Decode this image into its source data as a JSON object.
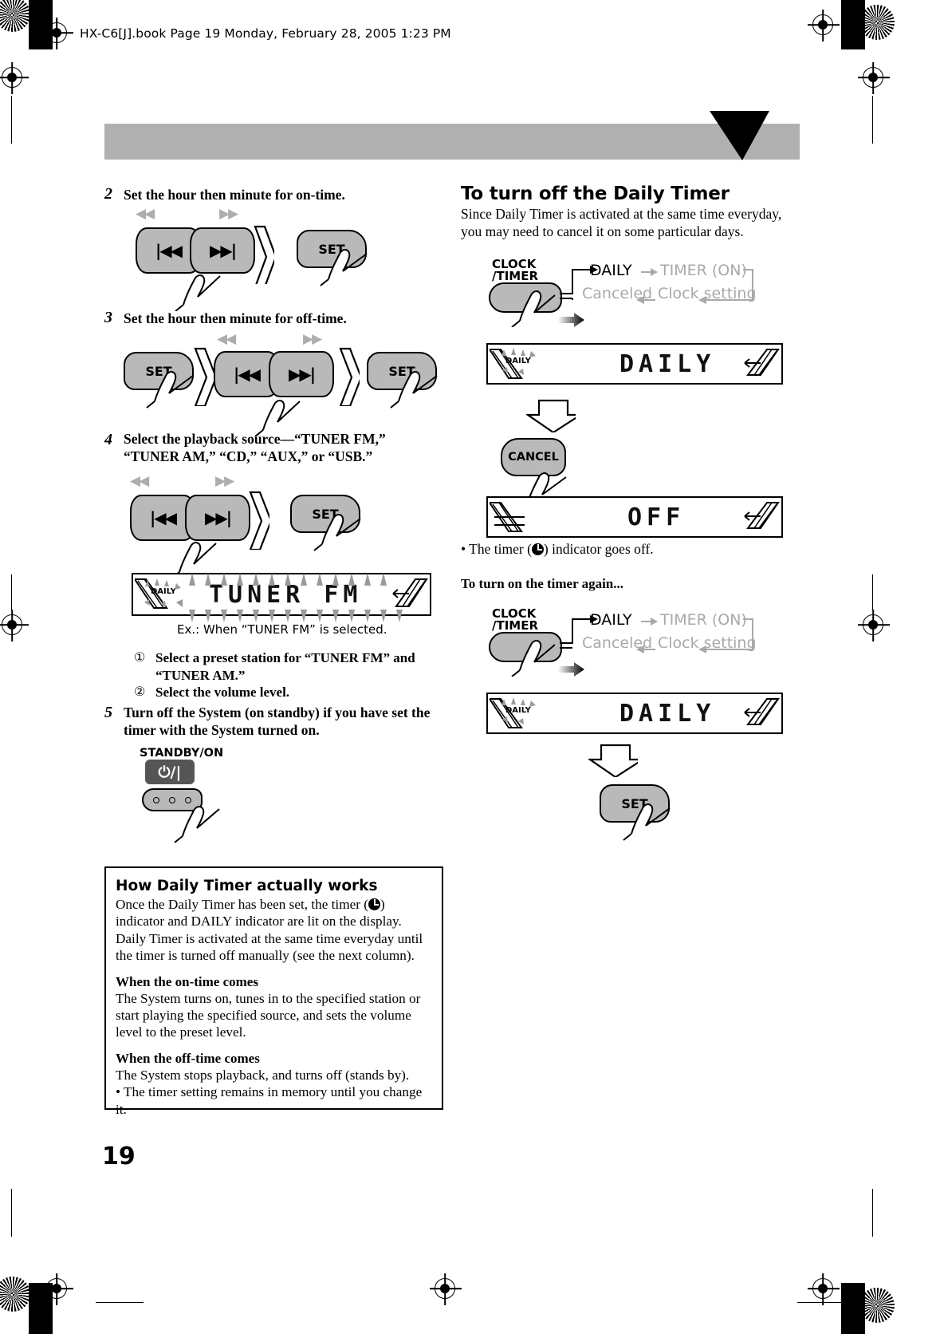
{
  "header": {
    "file_line": "HX-C6[J].book  Page 19  Monday, February 28, 2005  1:23 PM"
  },
  "page_number": "19",
  "left_column": {
    "steps": [
      {
        "num": "2",
        "text": "Set the hour then minute for on-time.",
        "keys": [
          "skip-back",
          "skip-fwd",
          "SET"
        ]
      },
      {
        "num": "3",
        "text": "Set the hour then minute for off-time.",
        "keys": [
          "SET",
          "skip-back",
          "skip-fwd",
          "SET"
        ]
      },
      {
        "num": "4",
        "text": "Select the playback source—“TUNER FM,” “TUNER AM,” “CD,” “AUX,” or “USB.”",
        "keys": [
          "skip-back",
          "skip-fwd",
          "SET"
        ]
      },
      {
        "num": "5",
        "text": "Turn off the System (on standby) if you have set the timer with the System turned on.",
        "keys": [
          "STANDBY/ON"
        ]
      }
    ],
    "display_step4": {
      "value": "TUNER FM",
      "daily_indicator": "DAILY",
      "caption": "Ex.: When “TUNER FM” is selected."
    },
    "substeps": [
      {
        "marker": "①",
        "text": "Select a preset station for “TUNER FM” and “TUNER AM.”"
      },
      {
        "marker": "②",
        "text": "Select the volume level."
      }
    ],
    "standby_label": "STANDBY/ON",
    "standby_glyph": "⏻/|"
  },
  "info_box": {
    "title": "How Daily Timer actually works",
    "intro": "Once the Daily Timer has been set, the timer (  ) indicator and DAILY indicator are lit on the display. Daily Timer is activated at the same time everyday until the timer is turned off manually (see the next column).",
    "intro_part1": "Once the Daily Timer has been set, the timer (",
    "intro_part2": ") indicator and DAILY indicator are lit on the display. Daily Timer is activated at the same time everyday until the timer is turned off manually (see the next column).",
    "sections": [
      {
        "heading": "When the on-time comes",
        "body": "The System turns on, tunes in to the specified station or start playing the specified source, and sets the volume level to the preset level."
      },
      {
        "heading": "When the off-time comes",
        "body": "The System stops playback, and turns off (stands by).",
        "bullet": "• The timer setting remains in memory until you change it."
      }
    ]
  },
  "right_column": {
    "heading": "To turn off the Daily Timer",
    "intro": "Since Daily Timer is activated at the same time everyday, you may need to cancel it on some particular days.",
    "button_label_line1": "CLOCK",
    "button_label_line2": "/TIMER",
    "flow": {
      "top_left": "DAILY",
      "top_right": "TIMER (ON)",
      "bottom_right": "Clock setting",
      "bottom_left": "Canceled"
    },
    "display_1": {
      "value": "DAILY",
      "daily_indicator": "DAILY"
    },
    "cancel_button": "CANCEL",
    "display_2": {
      "value": "OFF"
    },
    "note_part1": "• The timer (",
    "note_part2": ") indicator goes off.",
    "subheading": "To turn on the timer again...",
    "flow2": {
      "top_left": "DAILY",
      "top_right": "TIMER (ON)",
      "bottom_right": "Clock setting",
      "bottom_left": "Canceled"
    },
    "display_3": {
      "value": "DAILY",
      "daily_indicator": "DAILY"
    },
    "set_button": "SET"
  },
  "colors": {
    "banner": "#b0b0b0",
    "key_fill": "#b9b9b9",
    "grey_text": "#a9a9a9",
    "standby_fill": "#555555"
  }
}
